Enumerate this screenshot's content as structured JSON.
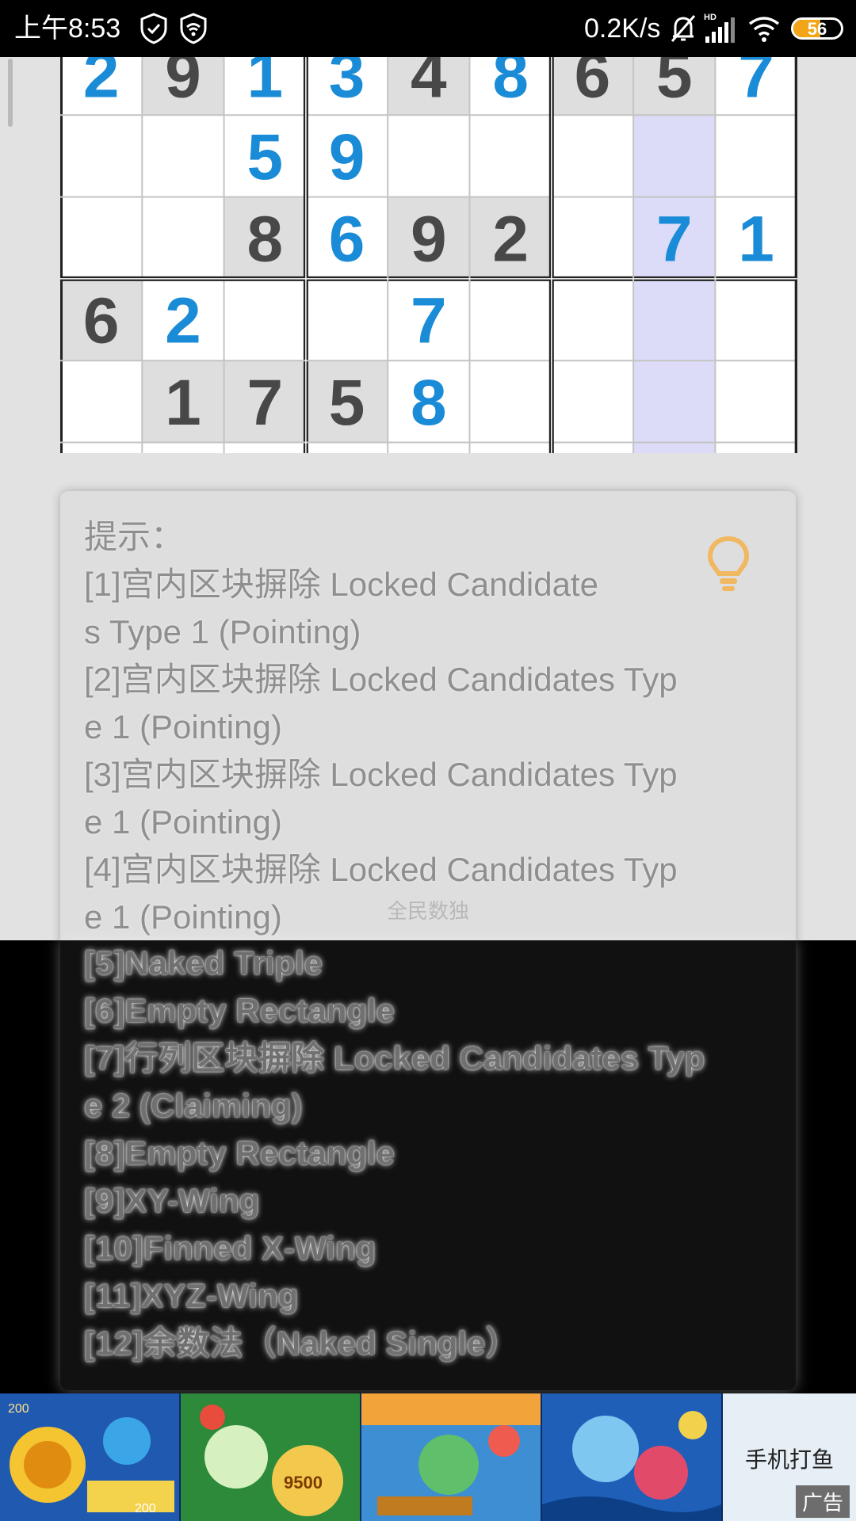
{
  "status_bar": {
    "time": "上午8:53",
    "network_speed": "0.2K/s",
    "battery_level": "56",
    "icons": [
      "shield-check-icon",
      "wifi-sim-icon",
      "mute-bell-icon",
      "hd-signal-icon",
      "wifi-icon",
      "battery-icon"
    ]
  },
  "sudoku": {
    "rows": [
      [
        {
          "v": "2",
          "given": false
        },
        {
          "v": "9",
          "given": true
        },
        {
          "v": "1",
          "given": false
        },
        {
          "v": "3",
          "given": false
        },
        {
          "v": "4",
          "given": true
        },
        {
          "v": "8",
          "given": false
        },
        {
          "v": "6",
          "given": true
        },
        {
          "v": "5",
          "given": true
        },
        {
          "v": "7",
          "given": false
        }
      ],
      [
        {
          "v": "",
          "given": false
        },
        {
          "v": "",
          "given": false
        },
        {
          "v": "5",
          "given": false
        },
        {
          "v": "9",
          "given": false
        },
        {
          "v": "",
          "given": false
        },
        {
          "v": "",
          "given": false
        },
        {
          "v": "",
          "given": false
        },
        {
          "v": "",
          "given": false
        },
        {
          "v": "",
          "given": false
        }
      ],
      [
        {
          "v": "",
          "given": false
        },
        {
          "v": "",
          "given": false
        },
        {
          "v": "8",
          "given": true
        },
        {
          "v": "6",
          "given": false
        },
        {
          "v": "9",
          "given": true
        },
        {
          "v": "2",
          "given": true
        },
        {
          "v": "",
          "given": false
        },
        {
          "v": "7",
          "given": false
        },
        {
          "v": "1",
          "given": false
        }
      ],
      [
        {
          "v": "6",
          "given": true
        },
        {
          "v": "2",
          "given": false
        },
        {
          "v": "",
          "given": false
        },
        {
          "v": "",
          "given": false
        },
        {
          "v": "7",
          "given": false
        },
        {
          "v": "",
          "given": false
        },
        {
          "v": "",
          "given": false
        },
        {
          "v": "",
          "given": false
        },
        {
          "v": "",
          "given": false
        }
      ],
      [
        {
          "v": "",
          "given": false
        },
        {
          "v": "1",
          "given": true
        },
        {
          "v": "7",
          "given": true
        },
        {
          "v": "5",
          "given": true
        },
        {
          "v": "8",
          "given": false
        },
        {
          "v": "",
          "given": false
        },
        {
          "v": "",
          "given": false
        },
        {
          "v": "",
          "given": false
        },
        {
          "v": "",
          "given": false
        }
      ]
    ],
    "highlight_column": 7,
    "colors": {
      "user_digit": "#1a8bd6",
      "given_digit": "#484848",
      "given_bg": "#dedede",
      "highlight_bg": "#dcdcf8"
    }
  },
  "hints": {
    "title": "提示：",
    "lines": [
      "[1]宫内区块摒除 Locked Candidate",
      "s Type 1 (Pointing)",
      "[2]宫内区块摒除 Locked Candidates Typ",
      "e 1 (Pointing)",
      "[3]宫内区块摒除 Locked Candidates Typ",
      "e 1 (Pointing)",
      "[4]宫内区块摒除 Locked Candidates Typ",
      "e 1 (Pointing)"
    ],
    "dimmed_lines": [
      "[5]Naked Triple",
      "[6]Empty Rectangle",
      "[7]行列区块摒除 Locked Candidates Typ",
      "e 2 (Claiming)",
      "[8]Empty Rectangle",
      "[9]XY-Wing",
      "[10]Finned X-Wing",
      "[11]XYZ-Wing",
      "[12]余数法（Naked Single）"
    ],
    "bulb_color": "#f0b860"
  },
  "watermark": "全民数独",
  "ad": {
    "label": "手机打鱼",
    "tag": "广告"
  }
}
